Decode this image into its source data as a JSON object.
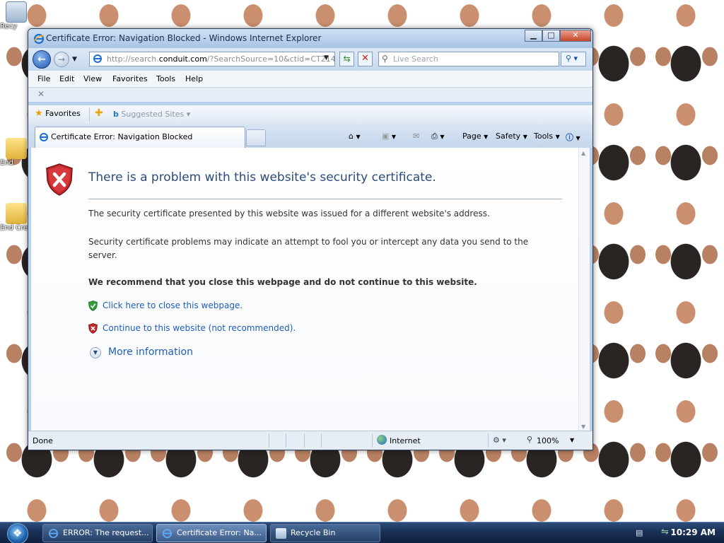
{
  "desktop": {
    "icons": [
      {
        "label": "Recy"
      },
      {
        "label": "End"
      },
      {
        "label": "End Cre"
      }
    ]
  },
  "window": {
    "title": "Certificate Error: Navigation Blocked - Windows Internet Explorer",
    "address": {
      "prefix": "http://search.",
      "host": "conduit.com",
      "suffix": "/?SearchSource=10&ctid=CT2144261"
    },
    "search_placeholder": "Live Search",
    "menu": [
      "File",
      "Edit",
      "View",
      "Favorites",
      "Tools",
      "Help"
    ],
    "favorites_label": "Favorites",
    "suggested_sites": "Suggested Sites",
    "tab_label": "Certificate Error: Navigation Blocked",
    "commands": {
      "page": "Page",
      "safety": "Safety",
      "tools": "Tools"
    }
  },
  "page": {
    "title": "There is a problem with this website's security certificate.",
    "para1": "The security certificate presented by this website was issued for a different website's address.",
    "para2": "Security certificate problems may indicate an attempt to fool you or intercept any data you send to the server.",
    "recommend": "We recommend that you close this webpage and do not continue to this website.",
    "close_link": "Click here to close this webpage.",
    "continue_link": "Continue to this website (not recommended).",
    "more_info": "More information"
  },
  "status": {
    "text": "Done",
    "zone": "Internet",
    "zoom": "100%"
  },
  "taskbar": {
    "tasks": [
      {
        "label": "ERROR: The request..."
      },
      {
        "label": "Certificate Error: Na..."
      },
      {
        "label": "Recycle Bin"
      }
    ],
    "clock": "10:29 AM"
  },
  "colors": {
    "link": "#1e5eb8",
    "title": "#2c4a7a",
    "shield_red": "#c0282b",
    "shield_green": "#2f9e3a"
  }
}
